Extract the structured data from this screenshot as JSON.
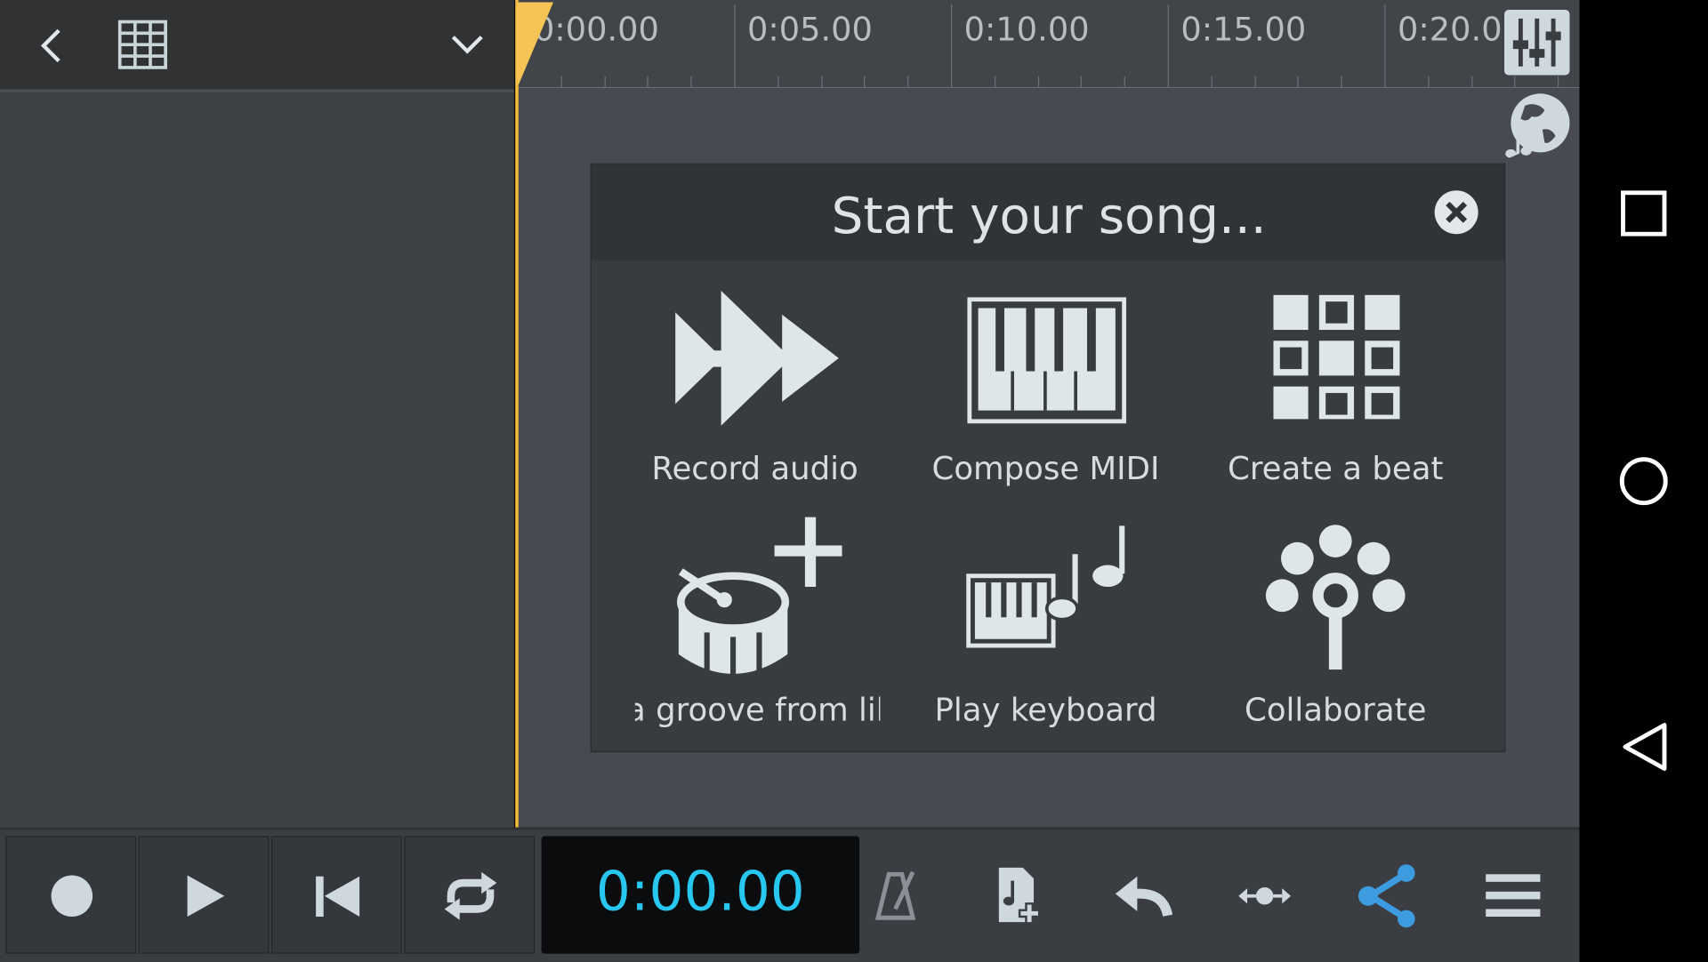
{
  "toolbar": {
    "back_icon": "chevron-left-icon",
    "grid_icon": "grid-icon",
    "dropdown_icon": "chevron-down-icon"
  },
  "timeline": {
    "labels": [
      "0:00.00",
      "0:05.00",
      "0:10.00",
      "0:15.00",
      "0:20.00"
    ],
    "playhead_color": "#f0b83c"
  },
  "right_icons": {
    "mixer": "mixer-icon",
    "community": "globe-music-icon"
  },
  "dialog": {
    "title": "Start your song...",
    "close_icon": "close-circle-icon",
    "options": [
      {
        "label": "Record audio",
        "icon": "record-audio-icon"
      },
      {
        "label": "Compose MIDI",
        "icon": "piano-icon"
      },
      {
        "label": "Create a beat",
        "icon": "beat-pads-icon"
      },
      {
        "label": "Add a groove from library",
        "visible_label": "a groove from li",
        "icon": "drum-add-icon"
      },
      {
        "label": "Play keyboard",
        "icon": "keyboard-notes-icon"
      },
      {
        "label": "Collaborate",
        "icon": "collaborate-icon"
      }
    ]
  },
  "transport": {
    "time": "0:00.00",
    "time_color": "#27c7ef",
    "buttons": [
      "record",
      "play",
      "rewind",
      "loop"
    ]
  },
  "bottom_icons": [
    "metronome-icon",
    "add-audio-file-icon",
    "undo-icon",
    "zoom-fit-icon",
    "share-icon",
    "menu-icon"
  ],
  "accent": "#3d9be0"
}
